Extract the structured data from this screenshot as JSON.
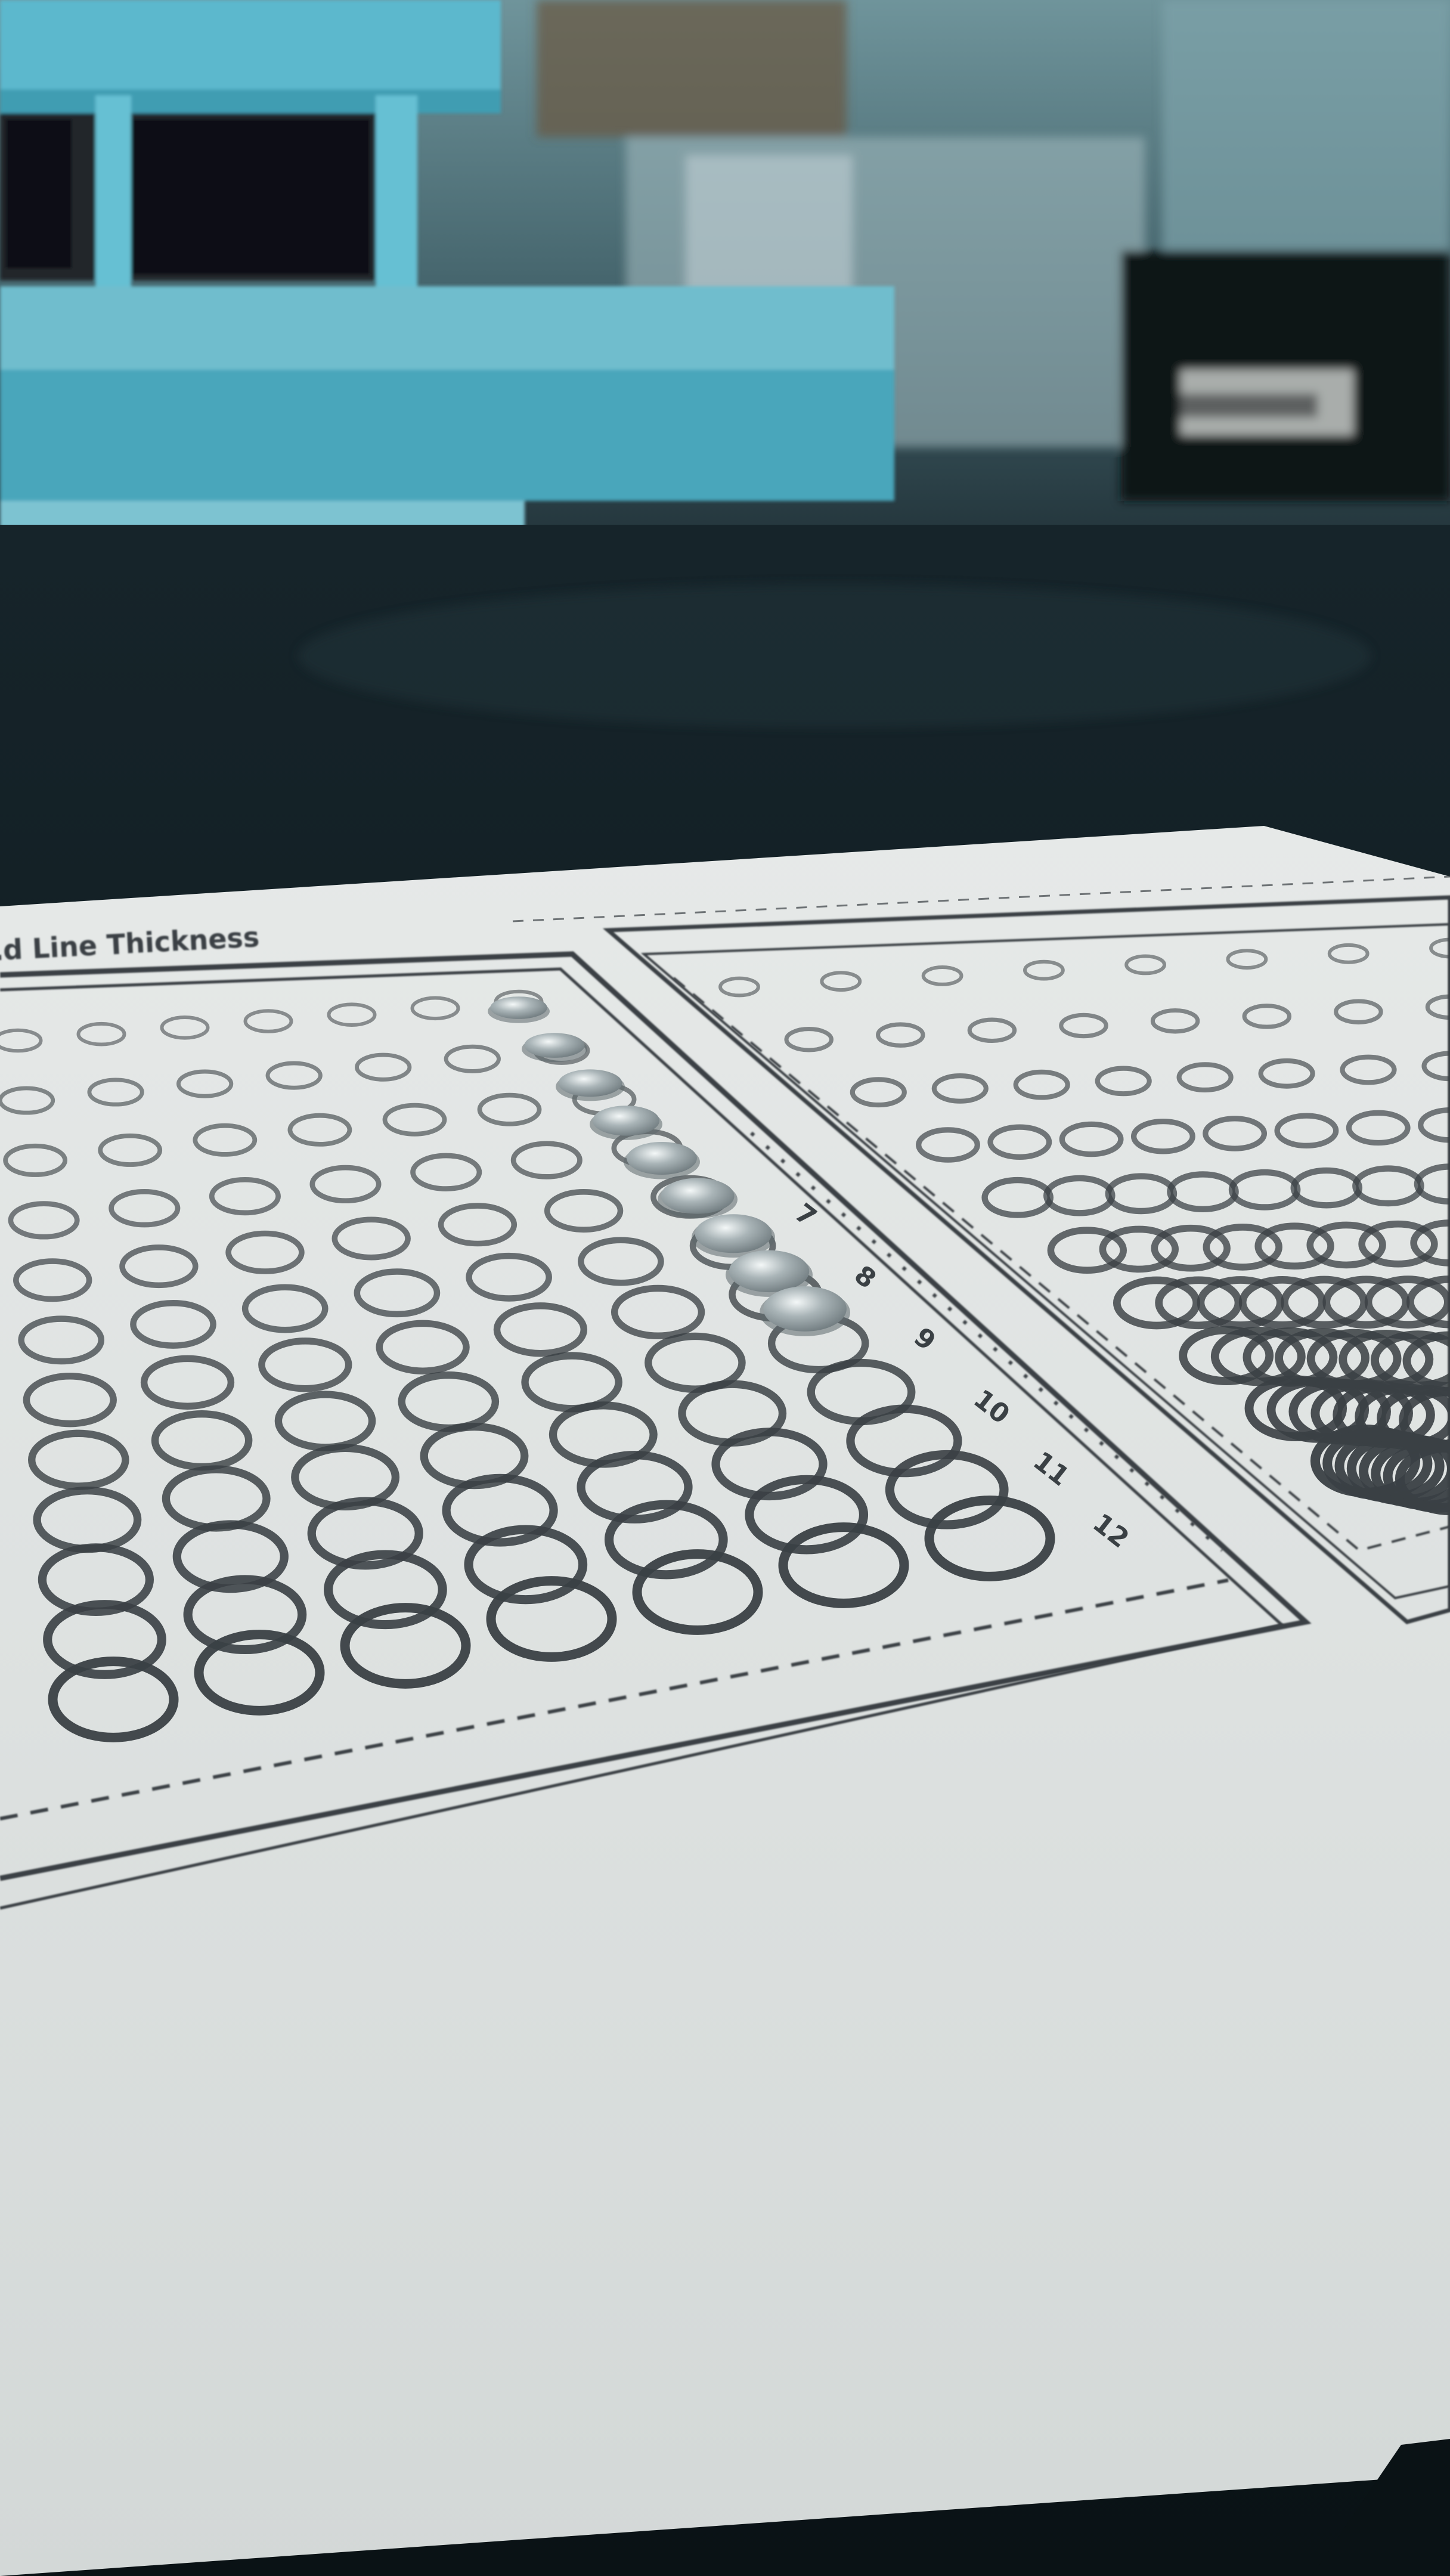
{
  "scene": {
    "description_free": true,
    "colors": {
      "paper": "#dfe3e2",
      "paper_shadow": "#c9cfcf",
      "ink": "#3a4044",
      "bench": "#0f1a1f",
      "rack": "#4fb3c8",
      "background": "#5a7f86",
      "droplet": "#9aa6aa"
    }
  },
  "template": {
    "title_fragment": "…d Line Thickness",
    "row_numbers": [
      "7",
      "8",
      "9",
      "10",
      "11",
      "12"
    ],
    "droplet_count": 9,
    "left_plate": {
      "rows": 12,
      "columns": 8
    },
    "right_plate": {
      "rows": 12,
      "columns": 8
    }
  }
}
